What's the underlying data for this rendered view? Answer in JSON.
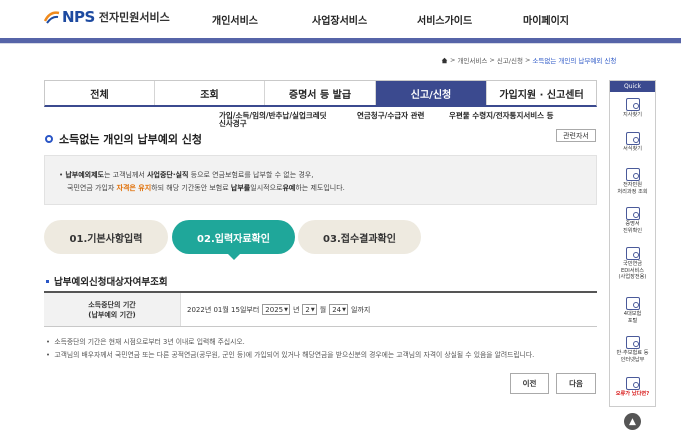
{
  "header": {
    "logo_text": "NPS",
    "logo_sub": "전자민원서비스",
    "nav": [
      "개인서비스",
      "사업장서비스",
      "서비스가이드",
      "마이페이지"
    ]
  },
  "breadcrumb": {
    "home_icon": "home-icon",
    "items": [
      "개인서비스",
      "신고/신청",
      "소득없는 개인의 납부예외 신청"
    ]
  },
  "tabs": [
    "전체",
    "조회",
    "증명서 등 발급",
    "신고/신청",
    "가입지원 · 신고센터"
  ],
  "active_tab": "신고/신청",
  "subnav": {
    "item1_line1": "가입/소득/임의/반추납/실업크레딧",
    "item1_line2": "신사경구",
    "item2": "연금청구/수급자 관련",
    "item3": "우편물 수령지/전자통지서비스 등"
  },
  "title": "소득없는 개인의 납부예외 신청",
  "related_button": "관련자서",
  "info": {
    "line1_b1": "납부예외제도",
    "line1_t1": "는 고객님께서 ",
    "line1_b2": "사업중단·실직",
    "line1_t2": " 등으로 연금보험료를 납부할 수 없는 경우,",
    "line2_t1": "국민연금 가입자 ",
    "line2_o": "자격은 유지",
    "line2_t2": "하되 해당 기간동안 보험료 ",
    "line2_b": "납부를",
    "line2_t3": "일시적으로",
    "line2_b2": "유예",
    "line2_t4": "하는 제도입니다."
  },
  "steps": [
    "01.기본사항입력",
    "02.입력자료확인",
    "03.접수결과확인"
  ],
  "active_step": 1,
  "section_title": "납부예외신청대상자여부조회",
  "form": {
    "label_line1": "소득중단의 기간",
    "label_line2": "(납부예외 기간)",
    "start_text": "2022년 01월 15일부터",
    "year_value": "2025",
    "year_unit": "년",
    "month_value": "2",
    "month_unit": "월",
    "day_value": "24",
    "day_unit": "일까지"
  },
  "notes": [
    "소득중단의 기간은 현재 시점으로부터 3년 이내로 입력해 주십시오.",
    "고객님의 배우자께서 국민연금 또는 다른 공적연금(공무원, 군인 등)에 가입되어 있거나 해당연금을 받으신분의 경우에는 고객님의 자격이 상실될 수 있음을 알려드립니다."
  ],
  "buttons": {
    "prev": "이전",
    "next": "다음"
  },
  "quick": {
    "header": "Quick",
    "items": [
      {
        "line1": "지사찾기",
        "line2": ""
      },
      {
        "line1": "서식찾기",
        "line2": ""
      },
      {
        "line1": "전자민원",
        "line2": "처리과정 조회"
      },
      {
        "line1": "증명서",
        "line2": "진위확인"
      },
      {
        "line1": "국민연금",
        "line2": "EDI서비스",
        "line3": "(사업장전용)"
      },
      {
        "line1": "4대보험",
        "line2": "포털"
      },
      {
        "line1": "반·추보험료 등",
        "line2": "인터넷납부"
      },
      {
        "line1": "오류가 났다면?",
        "line2": ""
      }
    ]
  },
  "colors": {
    "primary": "#3b4a8f",
    "step_active": "#1fa79a",
    "accent_orange": "#e06c00"
  }
}
